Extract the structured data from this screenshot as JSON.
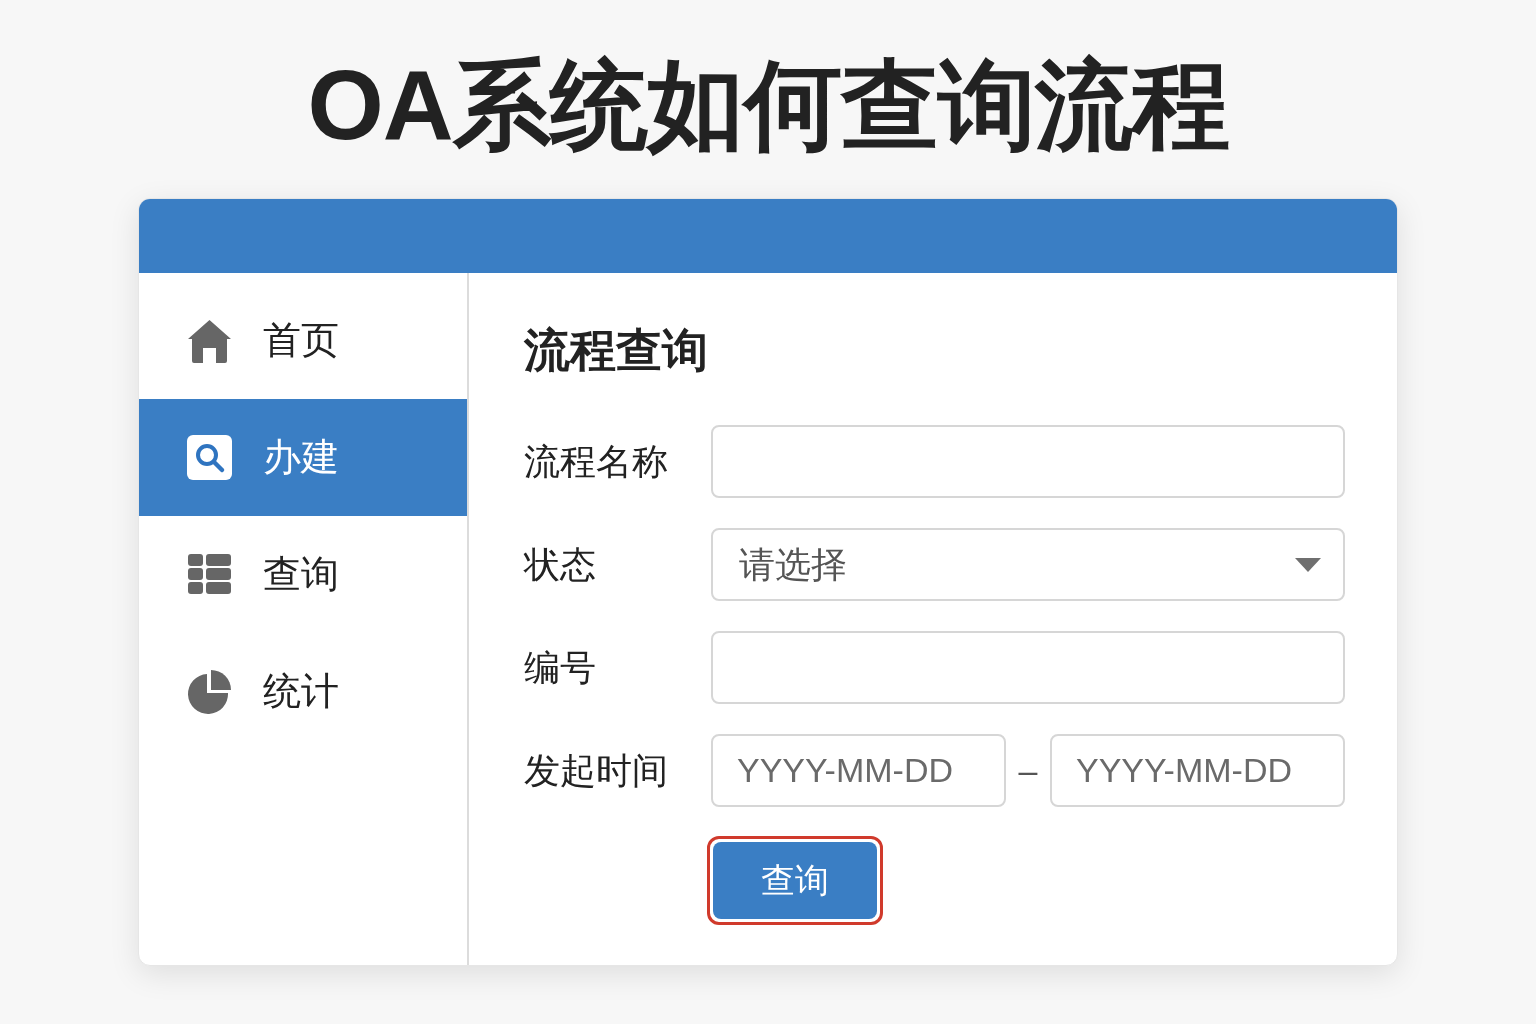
{
  "title": "OA系统如何查询流程",
  "sidebar": {
    "items": [
      {
        "label": "首页",
        "selected": false
      },
      {
        "label": "办建",
        "selected": true
      },
      {
        "label": "查询",
        "selected": false
      },
      {
        "label": "统计",
        "selected": false
      }
    ]
  },
  "panel": {
    "heading": "流程查询",
    "fields": [
      {
        "kind": "text",
        "label": "流程名称"
      },
      {
        "kind": "select",
        "label": "状态",
        "placeholder": "请选择"
      },
      {
        "kind": "text",
        "label": "编号"
      },
      {
        "kind": "date_range",
        "label": "发起时间",
        "start_placeholder": "YYYY-MM-DD",
        "separator": "–",
        "end_placeholder": "YYYY-MM-DD"
      }
    ],
    "query_button": {
      "label": "查询",
      "highlighted": true
    }
  }
}
